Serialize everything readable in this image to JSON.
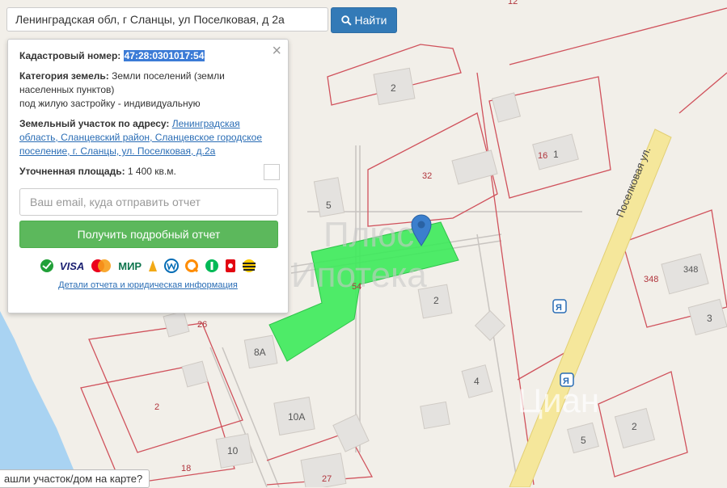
{
  "search": {
    "value": "Ленинградская обл, г Сланцы, ул Поселковая, д 2а",
    "button_label": "Найти"
  },
  "popup": {
    "cadastral_label": "Кадастровый номер:",
    "cadastral_number": "47:28:0301017:54",
    "category_label": "Категория земель:",
    "category_value_line1": " Земли поселений (земли",
    "category_value_line2": "населенных пунктов)",
    "category_value_line3": "под жилую застройку - индивидуальную",
    "address_label": "Земельный участок по адресу:",
    "address_line1": "Ленинградская",
    "address_line2": "область, Сланцевский район, Сланцевское городское",
    "address_line3": "поселение, г. Сланцы, ул. Поселковая, д.2а",
    "area_label": "Уточненная площадь:",
    "area_value": " 1 400 кв.м.",
    "email_placeholder": "Ваш email, куда отправить отчет",
    "report_button": "Получить подробный отчет",
    "payments": [
      "VISA",
      "МИР"
    ],
    "details_link": "Детали отчета и юридическая информация",
    "close": "×"
  },
  "bottom_tip": "ашли участок/дом на карте?",
  "map": {
    "street_label": "Поселковая ул.",
    "watermark_line1": "Плюс",
    "watermark_line2": "Ипотека",
    "watermark_brand": "Циан",
    "labels": [
      "12",
      "2",
      "16",
      "1",
      "32",
      "5",
      "348",
      "348",
      "54",
      "2",
      "3",
      "26",
      "8А",
      "4",
      "2",
      "10А",
      "10",
      "18",
      "2",
      "5",
      "27"
    ],
    "colors": {
      "parcel": "#3cea5a",
      "road": "#f5e79b",
      "water": "#a9d3f2",
      "boundary": "#d0525c"
    }
  }
}
